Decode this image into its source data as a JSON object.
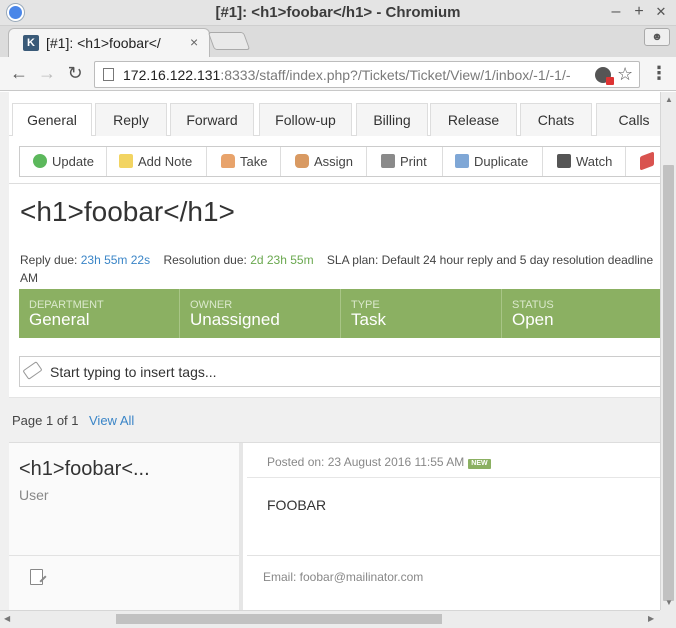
{
  "window": {
    "title": "[#1]: <h1>foobar</h1> - Chromium",
    "minimize": "–",
    "maximize": "+",
    "close": "✕"
  },
  "browser_tab": {
    "favicon_letter": "K",
    "title": "[#1]: <h1>foobar</",
    "close": "×"
  },
  "toolbar": {
    "back": "←",
    "forward": "→",
    "reload": "↻",
    "url_host": "172.16.122.131",
    "url_rest": ":8333/staff/index.php?/Tickets/Ticket/View/1/inbox/-1/-1/-",
    "star": "☆",
    "menu": "⋮"
  },
  "page_tabs": [
    {
      "label": "General",
      "active": true
    },
    {
      "label": "Reply"
    },
    {
      "label": "Forward"
    },
    {
      "label": "Follow-up"
    },
    {
      "label": "Billing"
    },
    {
      "label": "Release"
    },
    {
      "label": "Chats"
    },
    {
      "label": "Calls"
    }
  ],
  "actions": [
    {
      "label": "Update",
      "icon": "check-circle-icon",
      "color": "#5cb85c"
    },
    {
      "label": "Add Note",
      "icon": "note-icon",
      "color": "#f2d462"
    },
    {
      "label": "Take",
      "icon": "hand-icon",
      "color": "#e8a36b"
    },
    {
      "label": "Assign",
      "icon": "pointing-hand-icon",
      "color": "#d99a62"
    },
    {
      "label": "Print",
      "icon": "printer-icon",
      "color": "#8a8a8a"
    },
    {
      "label": "Duplicate",
      "icon": "duplicate-icon",
      "color": "#7fa7d6"
    },
    {
      "label": "Watch",
      "icon": "binoculars-icon",
      "color": "#555555"
    },
    {
      "label": "",
      "icon": "flag-icon",
      "color": "#d9534f"
    }
  ],
  "ticket": {
    "subject": "<h1>foobar</h1>",
    "reply_due_label": "Reply due:",
    "reply_due_value": "23h 55m 22s",
    "resolution_due_label": "Resolution due:",
    "resolution_due_value": "2d 23h 55m",
    "sla_label": "SLA plan:",
    "sla_value": "Default 24 hour reply and 5 day resolution deadline",
    "sla_wrap": "AM"
  },
  "properties": [
    {
      "label": "Department",
      "value": "General"
    },
    {
      "label": "Owner",
      "value": "Unassigned"
    },
    {
      "label": "Type",
      "value": "Task"
    },
    {
      "label": "Status",
      "value": "Open"
    }
  ],
  "tags": {
    "placeholder": "Start typing to insert tags..."
  },
  "pager": {
    "text": "Page 1 of 1",
    "view_all": "View All"
  },
  "post": {
    "author": "<h1>foobar<...",
    "role": "User",
    "posted_on": "Posted on: 23 August 2016 11:55 AM",
    "new_badge": "NEW",
    "body": "FOOBAR",
    "email": "Email: foobar@mailinator.com"
  },
  "colors": {
    "status_bar": "#8bb062",
    "link": "#3a85c7",
    "due_green": "#6aa84f"
  }
}
